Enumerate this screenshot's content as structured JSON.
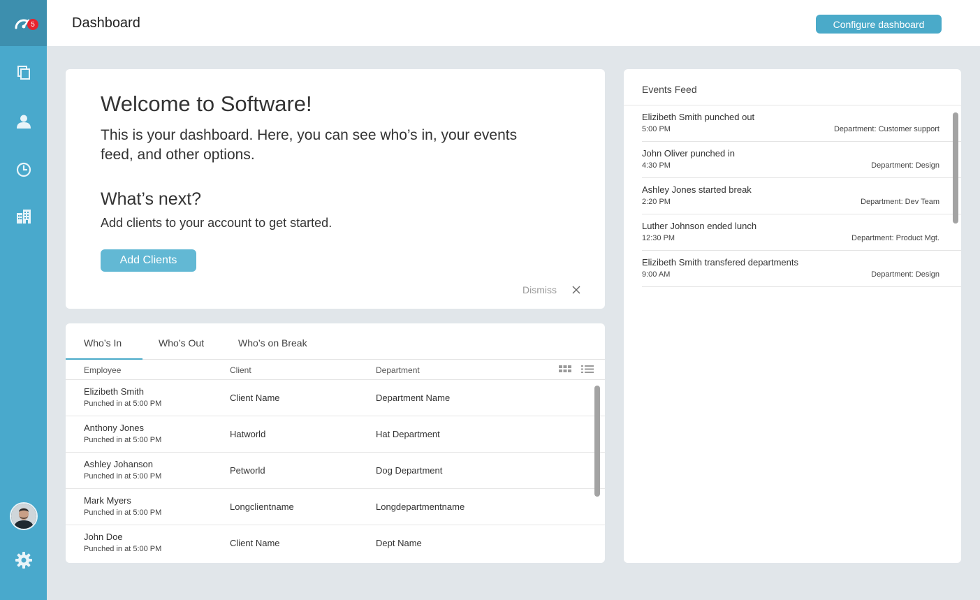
{
  "colors": {
    "sidebar": "#49a9cc",
    "sidebar_active": "#3d8fae",
    "accent": "#4aaac9",
    "badge": "#e8232e",
    "background": "#e1e6ea"
  },
  "sidebar": {
    "badge_count": "5",
    "items": [
      {
        "icon": "dashboard-gauge-icon"
      },
      {
        "icon": "copy-icon"
      },
      {
        "icon": "user-icon"
      },
      {
        "icon": "clock-icon"
      },
      {
        "icon": "building-icon"
      }
    ],
    "bottom": [
      {
        "icon": "avatar"
      },
      {
        "icon": "gear-icon"
      }
    ]
  },
  "header": {
    "title": "Dashboard",
    "configure_label": "Configure dashboard"
  },
  "welcome": {
    "heading": "Welcome to Software!",
    "intro": "This is your dashboard. Here, you can see who’s in, your events feed, and other options.",
    "next_heading": "What’s next?",
    "next_text": "Add clients to your account to get started.",
    "add_clients_label": "Add Clients",
    "dismiss_label": "Dismiss"
  },
  "whos": {
    "tabs": [
      {
        "label": "Who’s In"
      },
      {
        "label": "Who’s Out"
      },
      {
        "label": "Who’s on Break"
      }
    ],
    "columns": {
      "employee": "Employee",
      "client": "Client",
      "department": "Department"
    },
    "rows": [
      {
        "employee": "Elizibeth Smith",
        "status": "Punched in at 5:00 PM",
        "client": "Client Name",
        "department": "Department Name"
      },
      {
        "employee": "Anthony Jones",
        "status": "Punched in at 5:00 PM",
        "client": "Hatworld",
        "department": "Hat Department"
      },
      {
        "employee": "Ashley Johanson",
        "status": "Punched in at 5:00 PM",
        "client": "Petworld",
        "department": "Dog Department"
      },
      {
        "employee": "Mark Myers",
        "status": "Punched in at 5:00 PM",
        "client": "Longclientname",
        "department": "Longdepartmentname"
      },
      {
        "employee": "John Doe",
        "status": "Punched in at 5:00 PM",
        "client": "Client Name",
        "department": "Dept Name"
      }
    ]
  },
  "events": {
    "title": "Events Feed",
    "items": [
      {
        "title": "Elizibeth Smith punched out",
        "time": "5:00 PM",
        "department": "Department: Customer support"
      },
      {
        "title": "John Oliver punched in",
        "time": "4:30 PM",
        "department": "Department: Design"
      },
      {
        "title": "Ashley Jones started break",
        "time": "2:20 PM",
        "department": "Department: Dev Team"
      },
      {
        "title": "Luther Johnson ended lunch",
        "time": "12:30 PM",
        "department": "Department: Product Mgt."
      },
      {
        "title": "Elizibeth Smith transfered departments",
        "time": "9:00 AM",
        "department": "Department: Design"
      }
    ]
  }
}
